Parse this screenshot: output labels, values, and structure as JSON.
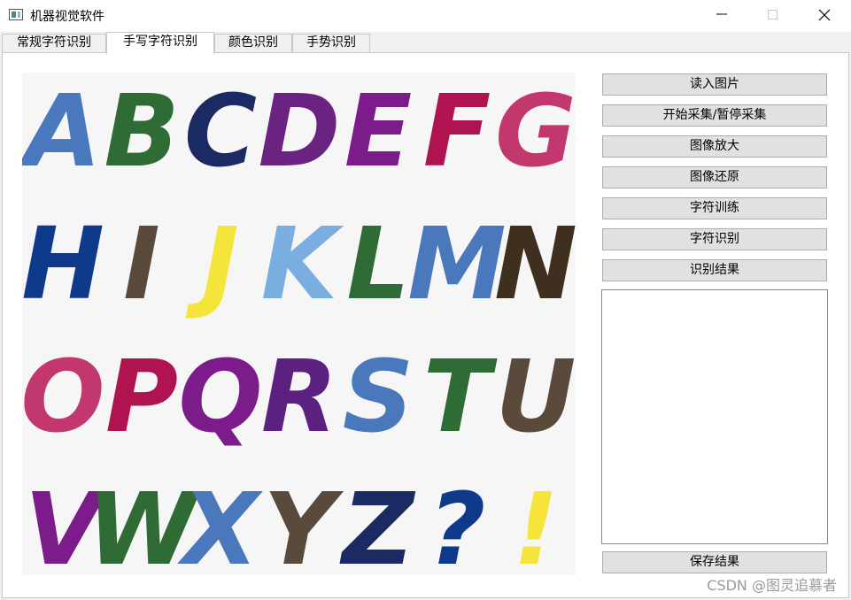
{
  "window": {
    "title": "机器视觉软件",
    "minimize_icon": "minimize-icon",
    "maximize_icon": "maximize-icon",
    "close_icon": "close-icon"
  },
  "tabs": [
    {
      "label": "常规字符识别",
      "active": false
    },
    {
      "label": "手写字符识别",
      "active": true
    },
    {
      "label": "颜色识别",
      "active": false
    },
    {
      "label": "手势识别",
      "active": false
    }
  ],
  "image": {
    "letters": [
      {
        "char": "A",
        "color": "#4a78bd"
      },
      {
        "char": "B",
        "color": "#2e6b35"
      },
      {
        "char": "C",
        "color": "#1b2a63"
      },
      {
        "char": "D",
        "color": "#6a2380"
      },
      {
        "char": "E",
        "color": "#7b1c8a"
      },
      {
        "char": "F",
        "color": "#b01450"
      },
      {
        "char": "G",
        "color": "#c2376e"
      },
      {
        "char": "H",
        "color": "#0f3a8c"
      },
      {
        "char": "I",
        "color": "#5a4a3c"
      },
      {
        "char": "J",
        "color": "#f5e53a"
      },
      {
        "char": "K",
        "color": "#7aaee0"
      },
      {
        "char": "L",
        "color": "#2e6b35"
      },
      {
        "char": "M",
        "color": "#4a78bd"
      },
      {
        "char": "N",
        "color": "#3e2f1e"
      },
      {
        "char": "O",
        "color": "#c2376e"
      },
      {
        "char": "P",
        "color": "#b01450"
      },
      {
        "char": "Q",
        "color": "#7b1c8a"
      },
      {
        "char": "R",
        "color": "#5b2080"
      },
      {
        "char": "S",
        "color": "#4a78bd"
      },
      {
        "char": "T",
        "color": "#2e6b35"
      },
      {
        "char": "U",
        "color": "#5a4a3c"
      },
      {
        "char": "V",
        "color": "#7b1c8a"
      },
      {
        "char": "W",
        "color": "#2e6b35"
      },
      {
        "char": "X",
        "color": "#4a78bd"
      },
      {
        "char": "Y",
        "color": "#5a4a3c"
      },
      {
        "char": "Z",
        "color": "#1b2a63"
      },
      {
        "char": "?",
        "color": "#0f3a8c"
      },
      {
        "char": "!",
        "color": "#f5e53a"
      }
    ]
  },
  "buttons": {
    "load_image": "读入图片",
    "start_stop_capture": "开始采集/暂停采集",
    "zoom_in": "图像放大",
    "restore": "图像还原",
    "train": "字符训练",
    "recognize": "字符识别",
    "result": "识别结果",
    "save_result": "保存结果"
  },
  "result_text": "",
  "watermark": "CSDN @图灵追慕者"
}
